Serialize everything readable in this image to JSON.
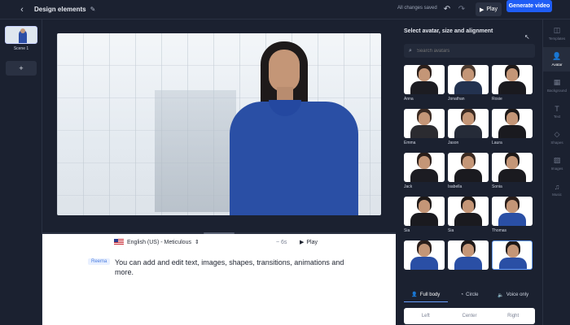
{
  "topbar": {
    "back_icon": "‹",
    "title": "Design elements",
    "edit_icon": "✎",
    "saved_status": "All changes saved",
    "undo_icon": "↶",
    "redo_icon": "↷",
    "play_icon": "▶",
    "play_label": "Play",
    "generate_label": "Generate video"
  },
  "scenes": {
    "items": [
      {
        "label": "Scene 1"
      }
    ],
    "add_icon": "+"
  },
  "editor": {
    "language": "English (US) - Meticulous",
    "language_chevron": "⇕",
    "duration": "~ 6s",
    "play_icon": "▶",
    "play_label": "Play",
    "speaker": "Reema",
    "script": "You can add and edit text, images, shapes, transitions, animations and more."
  },
  "panel": {
    "heading": "Select avatar, size and alignment",
    "cursor_icon": "↖",
    "search_icon": "⌕",
    "search_placeholder": "Search avatars",
    "avatars": [
      {
        "name": "Anna"
      },
      {
        "name": "Jonathan"
      },
      {
        "name": "Rosie"
      },
      {
        "name": "Emma"
      },
      {
        "name": "Jason"
      },
      {
        "name": "Laura"
      },
      {
        "name": "Jack"
      },
      {
        "name": "Isabella"
      },
      {
        "name": "Sonia"
      },
      {
        "name": "Sia"
      },
      {
        "name": "Sia"
      },
      {
        "name": "Thomas"
      },
      {
        "name": ""
      },
      {
        "name": ""
      },
      {
        "name": ""
      }
    ],
    "modes": [
      {
        "icon": "👤",
        "label": "Full body"
      },
      {
        "icon": "◔",
        "label": "Circle"
      },
      {
        "icon": "🔈",
        "label": "Voice only"
      }
    ],
    "alignment": [
      "Left",
      "Center",
      "Right"
    ]
  },
  "rail": {
    "tools": [
      {
        "icon": "◫",
        "label": "Templates"
      },
      {
        "icon": "👤",
        "label": "Avatar"
      },
      {
        "icon": "▦",
        "label": "Background"
      },
      {
        "icon": "T",
        "label": "Text"
      },
      {
        "icon": "◇",
        "label": "Shapes"
      },
      {
        "icon": "▨",
        "label": "Images"
      },
      {
        "icon": "♫",
        "label": "Music"
      }
    ]
  },
  "colors": {
    "background": "#1b2130",
    "accent": "#1f5df5",
    "shirt": "#2a4fa5"
  }
}
